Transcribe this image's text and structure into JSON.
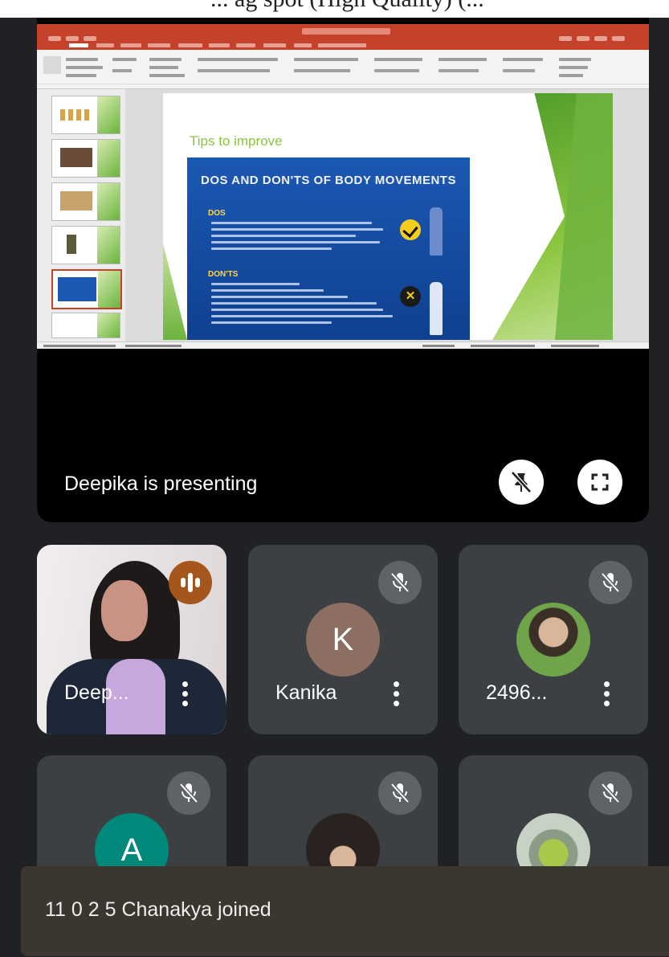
{
  "caption_fragment": "... ag spot (High Quality) (...",
  "presentation": {
    "presenter_label": "Deepika  is presenting",
    "slide_title": "Tips to improve",
    "infographic_heading": "DOS AND DON'TS OF BODY MOVEMENTS",
    "dos_label": "DOS",
    "donts_label": "DON'TS"
  },
  "participants": [
    {
      "name": "Deep...",
      "avatar": "video",
      "muted": false,
      "speaking": true
    },
    {
      "name": "Kanika",
      "avatar": "letter",
      "letter": "K",
      "avatar_color": "#8d6e63",
      "muted": true
    },
    {
      "name": "2496...",
      "avatar": "photo",
      "muted": true
    },
    {
      "name": "",
      "avatar": "letter",
      "letter": "A",
      "avatar_color": "#00897b",
      "muted": true
    },
    {
      "name": "",
      "avatar": "photo",
      "muted": true
    },
    {
      "name": "",
      "avatar": "photo",
      "muted": true
    }
  ],
  "toast": {
    "text": "11 0 2 5 Chanakya joined"
  },
  "colors": {
    "background": "#202124",
    "tile": "#3c4043",
    "speaking_badge": "#a4561c",
    "ppt_accent": "#c4412a",
    "slide_green": "#8cc63f"
  }
}
